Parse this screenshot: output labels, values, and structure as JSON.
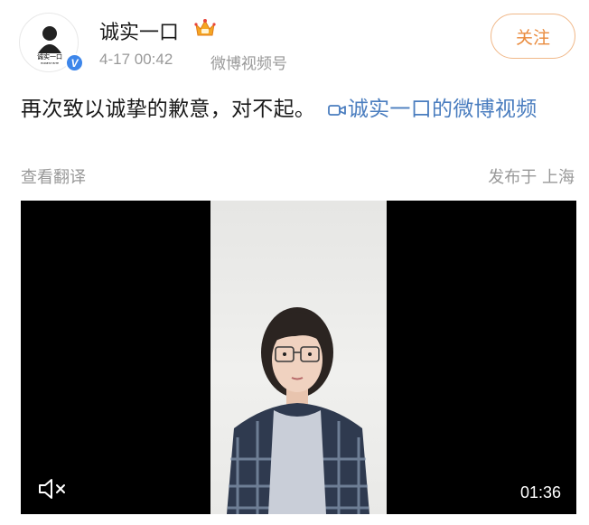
{
  "post": {
    "username": "诚实一口",
    "avatar_text": "诚实一口",
    "avatar_subtext": "HONEST BITE",
    "verified_badge": "V",
    "time": "4-17 00:42",
    "source": "微博视频号",
    "follow_label": "关注",
    "content_text": "再次致以诚挚的歉意，对不起。",
    "link_text": "诚实一口的微博视频",
    "translate_label": "查看翻译",
    "location_text": "发布于 上海"
  },
  "video": {
    "duration": "01:36",
    "muted": true
  },
  "icons": {
    "crown": "crown-icon",
    "camera": "video-camera-icon",
    "mute": "speaker-muted-icon"
  },
  "colors": {
    "link": "#4a7dbf",
    "follow": "#e98a3c",
    "verified": "#3d86ea",
    "meta": "#999999"
  }
}
